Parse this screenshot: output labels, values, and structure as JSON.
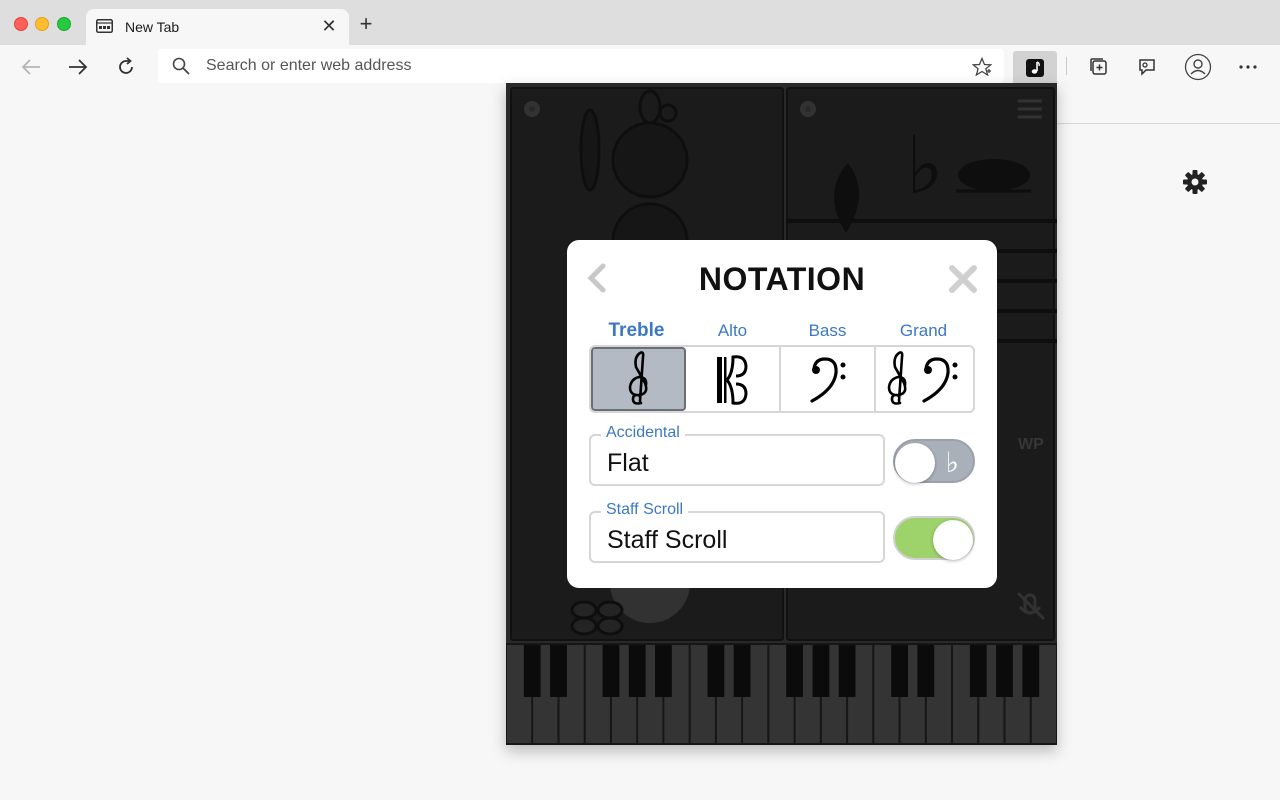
{
  "browser": {
    "tab_title": "New Tab",
    "address_placeholder": "Search or enter web address"
  },
  "modal": {
    "title": "NOTATION",
    "clefs": [
      {
        "label": "Treble",
        "selected": true
      },
      {
        "label": "Alto",
        "selected": false
      },
      {
        "label": "Bass",
        "selected": false
      },
      {
        "label": "Grand",
        "selected": false
      }
    ],
    "accidental": {
      "legend": "Accidental",
      "value": "Flat",
      "toggle_on": false,
      "toggle_glyph": "♭"
    },
    "staff_scroll": {
      "legend": "Staff Scroll",
      "value": "Staff Scroll",
      "toggle_on": true
    }
  },
  "background_app": {
    "wp_label": "WP"
  },
  "colors": {
    "accent_blue": "#3c78c4",
    "toggle_on_green": "#9dd36a",
    "toggle_off_gray": "#a9b0b9",
    "selected_clef_bg": "#b4bac3"
  }
}
